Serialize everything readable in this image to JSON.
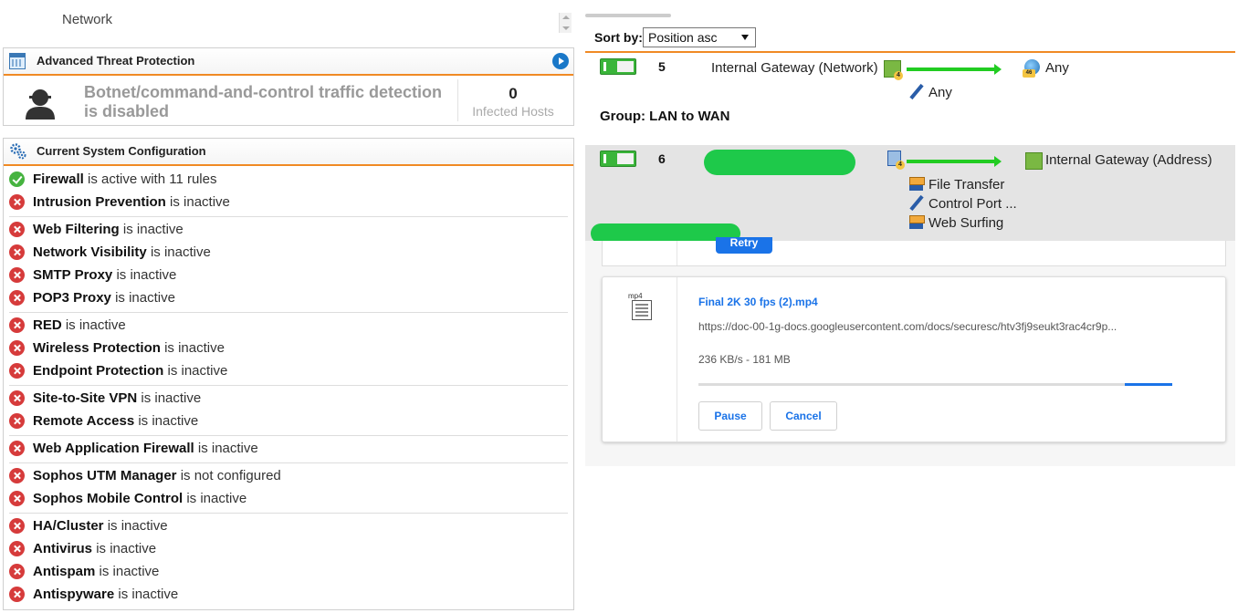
{
  "left": {
    "network_label": "Network",
    "atp": {
      "title": "Advanced Threat Protection",
      "message": "Botnet/command-and-control traffic detection is disabled",
      "infected_count": "0",
      "infected_label": "Infected Hosts"
    },
    "config": {
      "title": "Current System Configuration",
      "items": [
        {
          "name": "Firewall",
          "status": "is active with 11 rules",
          "state": "ok"
        },
        {
          "name": "Intrusion Prevention",
          "status": "is inactive",
          "state": "error"
        },
        {
          "name": "Web Filtering",
          "status": "is inactive",
          "state": "error"
        },
        {
          "name": "Network Visibility",
          "status": "is inactive",
          "state": "error"
        },
        {
          "name": "SMTP Proxy",
          "status": "is inactive",
          "state": "error"
        },
        {
          "name": "POP3 Proxy",
          "status": "is inactive",
          "state": "error"
        },
        {
          "name": "RED",
          "status": "is inactive",
          "state": "error"
        },
        {
          "name": "Wireless Protection",
          "status": "is inactive",
          "state": "error"
        },
        {
          "name": "Endpoint Protection",
          "status": "is inactive",
          "state": "error"
        },
        {
          "name": "Site-to-Site VPN",
          "status": "is inactive",
          "state": "error"
        },
        {
          "name": "Remote Access",
          "status": "is inactive",
          "state": "error"
        },
        {
          "name": "Web Application Firewall",
          "status": "is inactive",
          "state": "error"
        },
        {
          "name": "Sophos UTM Manager",
          "status": "is not configured",
          "state": "error"
        },
        {
          "name": "Sophos Mobile Control",
          "status": "is inactive",
          "state": "error"
        },
        {
          "name": "HA/Cluster",
          "status": "is inactive",
          "state": "error"
        },
        {
          "name": "Antivirus",
          "status": "is inactive",
          "state": "error"
        },
        {
          "name": "Antispam",
          "status": "is inactive",
          "state": "error"
        },
        {
          "name": "Antispyware",
          "status": "is inactive",
          "state": "error"
        }
      ]
    }
  },
  "right": {
    "sort_label": "Sort by:",
    "sort_value": "Position asc",
    "rule5": {
      "number": "5",
      "source": "Internal Gateway (Network)",
      "destination": "Any",
      "service": "Any",
      "source_badge": "4",
      "dest_badge": "46"
    },
    "group_label": "Group: LAN to WAN",
    "rule6": {
      "number": "6",
      "source_badge": "4",
      "destination": "Internal Gateway (Address)",
      "services": [
        "File Transfer",
        "Control Port ...",
        "Web Surfing"
      ]
    }
  },
  "downloads": {
    "retry_label": "Retry",
    "file": {
      "ext_label": "mp4",
      "name": "Final 2K 30 fps (2).mp4",
      "url": "https://doc-00-1g-docs.googleusercontent.com/docs/securesc/htv3fj9seukt3rac4cr9p...",
      "status": "236 KB/s - 181 MB",
      "progress": 0.1,
      "pause_label": "Pause",
      "cancel_label": "Cancel"
    }
  },
  "colors": {
    "accent_orange": "#f08a24",
    "error_red": "#d63b3b",
    "ok_green": "#46b340",
    "link_blue": "#1a73e8",
    "redaction_green": "#1ec94a"
  }
}
